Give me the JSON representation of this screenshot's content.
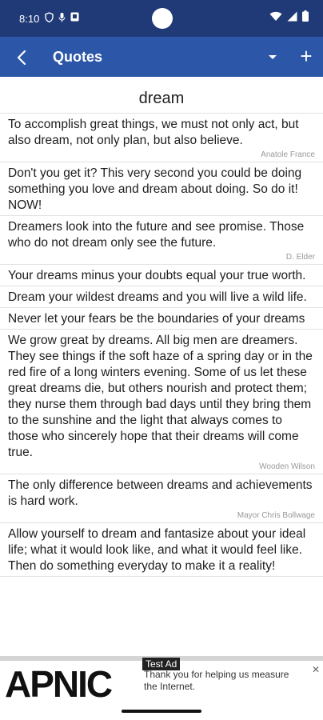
{
  "status_bar": {
    "time": "8:10"
  },
  "app_bar": {
    "title": "Quotes",
    "add_label": "+"
  },
  "topic": {
    "title": "dream"
  },
  "quotes": [
    {
      "text": "To accomplish great things,  we must not only act, but also dream, not only plan, but also believe.",
      "author": "Anatole France"
    },
    {
      "text": "Don't you get it?  This very second you could be doing something you love and dream about doing. So do it! NOW!",
      "author": ""
    },
    {
      "text": "Dreamers look into the future and see promise. Those who do not dream only see the future.",
      "author": "D. Elder"
    },
    {
      "text": "Your dreams minus your doubts equal your true worth.",
      "author": ""
    },
    {
      "text": "Dream your wildest dreams and you will live a wild life.",
      "author": ""
    },
    {
      "text": "Never let your fears be the boundaries of your dreams",
      "author": ""
    },
    {
      "text": "We grow great by dreams. All big men are dreamers. They see things if the soft haze of a spring day or in the red fire of a long winters evening. Some of us let these great dreams die, but others nourish and protect them; they nurse them through bad days until they bring them to the sunshine and the light that always comes to those who sincerely hope that their dreams will come true.",
      "author": "Wooden Wilson"
    },
    {
      "text": "The only difference between dreams and achievements is hard work.",
      "author": "Mayor Chris Bollwage"
    },
    {
      "text": "Allow yourself to dream and fantasize about your ideal life; what it would look like, and what it would feel like. Then do something everyday to make it a reality!",
      "author": ""
    }
  ],
  "ad": {
    "logo": "APNIC",
    "badge": "Test Ad",
    "text": "Thank you for helping us measure the Internet."
  }
}
